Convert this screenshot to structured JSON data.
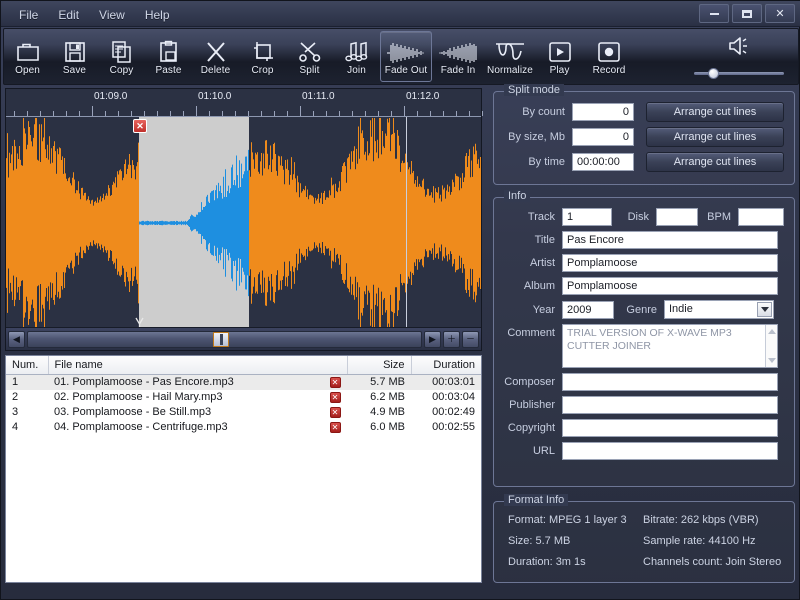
{
  "window": {
    "minimize_label": "–",
    "maximize_label": "□",
    "close_label": "✕"
  },
  "menubar": {
    "items": [
      "File",
      "Edit",
      "View",
      "Help"
    ]
  },
  "toolbar": {
    "buttons": [
      {
        "label": "Open",
        "icon": "folder-icon"
      },
      {
        "label": "Save",
        "icon": "floppy-disk-icon"
      },
      {
        "label": "Copy",
        "icon": "copy-icon"
      },
      {
        "label": "Paste",
        "icon": "clipboard-icon"
      },
      {
        "label": "Delete",
        "icon": "x-cross-icon"
      },
      {
        "label": "Crop",
        "icon": "crop-icon"
      },
      {
        "label": "Split",
        "icon": "scissors-icon"
      },
      {
        "label": "Join",
        "icon": "music-notes-icon"
      },
      {
        "label": "Fade Out",
        "icon": "fade-out-waveform-icon"
      },
      {
        "label": "Fade In",
        "icon": "fade-in-waveform-icon"
      },
      {
        "label": "Normalize",
        "icon": "normalize-curve-icon"
      },
      {
        "label": "Play",
        "icon": "play-icon"
      },
      {
        "label": "Record",
        "icon": "record-icon"
      }
    ],
    "active_button": "Fade Out",
    "volume": {
      "icon": "speaker-icon",
      "value": 16
    }
  },
  "waveform": {
    "ruler_labels": [
      "01:09.0",
      "01:10.0",
      "01:11.0",
      "01:12.0"
    ],
    "selection_marker_label": "✕",
    "scrollbar": {
      "left_arrow": "◀",
      "right_arrow": "▶",
      "zoom_in": "＋",
      "zoom_out": "－"
    },
    "colors": {
      "background": "#2b3143",
      "wave": "#ef8b1c",
      "selection_background": "#cdcdcd",
      "selection_wave": "#1e8fe0",
      "cursor": "#c9cfdd"
    }
  },
  "filelist": {
    "columns": [
      "Num.",
      "File name",
      "Size",
      "Duration"
    ],
    "rows": [
      {
        "num": "1",
        "name": "01. Pomplamoose - Pas Encore.mp3",
        "delete": "✕",
        "size": "5.7 MB",
        "duration": "00:03:01"
      },
      {
        "num": "2",
        "name": "02. Pomplamoose - Hail Mary.mp3",
        "delete": "✕",
        "size": "6.2 MB",
        "duration": "00:03:04"
      },
      {
        "num": "3",
        "name": "03. Pomplamoose - Be Still.mp3",
        "delete": "✕",
        "size": "4.9 MB",
        "duration": "00:02:49"
      },
      {
        "num": "4",
        "name": "04. Pomplamoose - Centrifuge.mp3",
        "delete": "✕",
        "size": "6.0 MB",
        "duration": "00:02:55"
      }
    ]
  },
  "split_mode": {
    "caption": "Split mode",
    "by_count_label": "By count",
    "by_count_value": "0",
    "by_size_label": "By size, Mb",
    "by_size_value": "0",
    "by_time_label": "By time",
    "by_time_value": "00:00:00",
    "arrange_label_1": "Arrange cut lines",
    "arrange_label_2": "Arrange cut lines",
    "arrange_label_3": "Arrange cut lines"
  },
  "info": {
    "caption": "Info",
    "track_label": "Track",
    "track_value": "1",
    "disk_label": "Disk",
    "disk_value": "",
    "bpm_label": "BPM",
    "bpm_value": "",
    "title_label": "Title",
    "title_value": "Pas Encore",
    "artist_label": "Artist",
    "artist_value": "Pomplamoose",
    "album_label": "Album",
    "album_value": "Pomplamoose",
    "year_label": "Year",
    "year_value": "2009",
    "genre_label": "Genre",
    "genre_value": "Indie",
    "comment_label": "Comment",
    "comment_value": "TRIAL VERSION OF X-WAVE MP3 CUTTER JOINER",
    "composer_label": "Composer",
    "composer_value": "",
    "publisher_label": "Publisher",
    "publisher_value": "",
    "copyright_label": "Copyright",
    "copyright_value": "",
    "url_label": "URL",
    "url_value": ""
  },
  "format_info": {
    "caption": "Format Info",
    "format": "Format: MPEG 1 layer 3",
    "bitrate": "Bitrate: 262 kbps (VBR)",
    "size": "Size: 5.7 MB",
    "sample_rate": "Sample rate: 44100 Hz",
    "duration": "Duration: 3m 1s",
    "channels": "Channels count: Join Stereo"
  }
}
